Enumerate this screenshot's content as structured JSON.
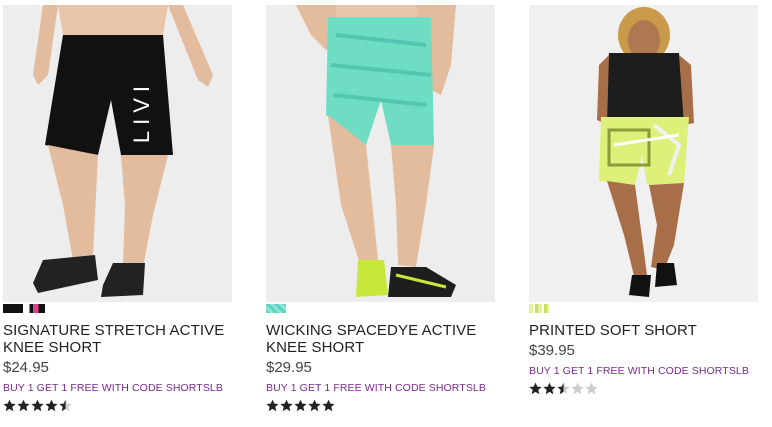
{
  "products": [
    {
      "name": "SIGNATURE STRETCH ACTIVE KNEE SHORT",
      "price": "$24.95",
      "promo": "BUY 1 GET 1 FREE WITH CODE SHORTSLB",
      "rating": 4.5,
      "swatches": [
        "#111111",
        "#ffffff",
        "#e0408a"
      ],
      "logo_text": "LIVI"
    },
    {
      "name": "WICKING SPACEDYE ACTIVE KNEE SHORT",
      "price": "$29.95",
      "promo": "BUY 1 GET 1 FREE WITH CODE SHORTSLB",
      "rating": 5,
      "swatches": [
        "#5fd3bf"
      ]
    },
    {
      "name": "PRINTED SOFT SHORT",
      "price": "$39.95",
      "promo": "BUY 1 GET 1 FREE WITH CODE SHORTSLB",
      "rating": 2.5,
      "swatches": [
        "#d6e89a"
      ]
    }
  ],
  "colors": {
    "promo": "#7a2a8c",
    "star_filled": "#222222",
    "star_empty": "#cccccc"
  }
}
